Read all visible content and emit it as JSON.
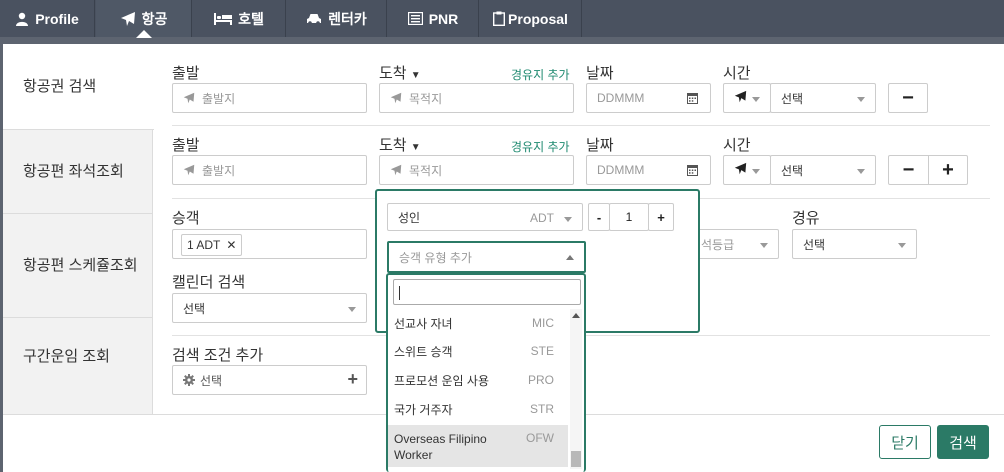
{
  "top_tabs": [
    {
      "label": "Profile",
      "icon": "person-icon"
    },
    {
      "label": "항공",
      "icon": "plane-icon",
      "active": true
    },
    {
      "label": "호텔",
      "icon": "bed-icon"
    },
    {
      "label": "렌터카",
      "icon": "car-icon"
    },
    {
      "label": "PNR",
      "icon": "list-icon"
    },
    {
      "label": "Proposal",
      "icon": "clipboard-icon"
    }
  ],
  "sidebar": {
    "items": [
      {
        "label": "항공권 검색"
      },
      {
        "label": "항공편 좌석조회"
      },
      {
        "label": "항공편 스케쥴조회"
      },
      {
        "label": "구간운임 조회"
      }
    ]
  },
  "row1": {
    "origin_label": "출발",
    "origin_placeholder": "출발지",
    "dest_label": "도착",
    "dest_placeholder": "목적지",
    "add_stopover": "경유지 추가",
    "date_label": "날짜",
    "date_placeholder": "DDMMM",
    "time_label": "시간",
    "time_value": "선택",
    "remove": "−"
  },
  "row2": {
    "origin_label": "출발",
    "origin_placeholder": "출발지",
    "dest_label": "도착",
    "dest_placeholder": "목적지",
    "add_stopover": "경유지 추가",
    "date_label": "날짜",
    "date_placeholder": "DDMMM",
    "time_label": "시간",
    "time_value": "선택",
    "remove": "−",
    "add": "+"
  },
  "passengers": {
    "label": "승객",
    "chip": "1 ADT",
    "chip_remove": "✕"
  },
  "cabin_partial": "석등급",
  "via": {
    "label": "경유",
    "value": "선택"
  },
  "calendar": {
    "label": "캘린더 검색",
    "value": "선택"
  },
  "extra": {
    "label": "검색 조건 추가",
    "value": "선택",
    "add": "+"
  },
  "popup": {
    "type_label": "성인",
    "type_code": "ADT",
    "minus": "-",
    "count": "1",
    "plus": "+",
    "add_type_placeholder": "승객 유형 추가"
  },
  "dropdown_options": [
    {
      "label": "선교사 자녀",
      "code": "MIC"
    },
    {
      "label": "스위트 승객",
      "code": "STE"
    },
    {
      "label": "프로모션 운임 사용",
      "code": "PRO"
    },
    {
      "label": "국가 거주자",
      "code": "STR"
    },
    {
      "label": "Overseas Filipino Worker",
      "code": "OFW",
      "highlighted": true
    }
  ],
  "footer": {
    "close": "닫기",
    "search": "검색"
  },
  "colors": {
    "accent": "#2b7a66",
    "topbar": "#4a5260"
  }
}
